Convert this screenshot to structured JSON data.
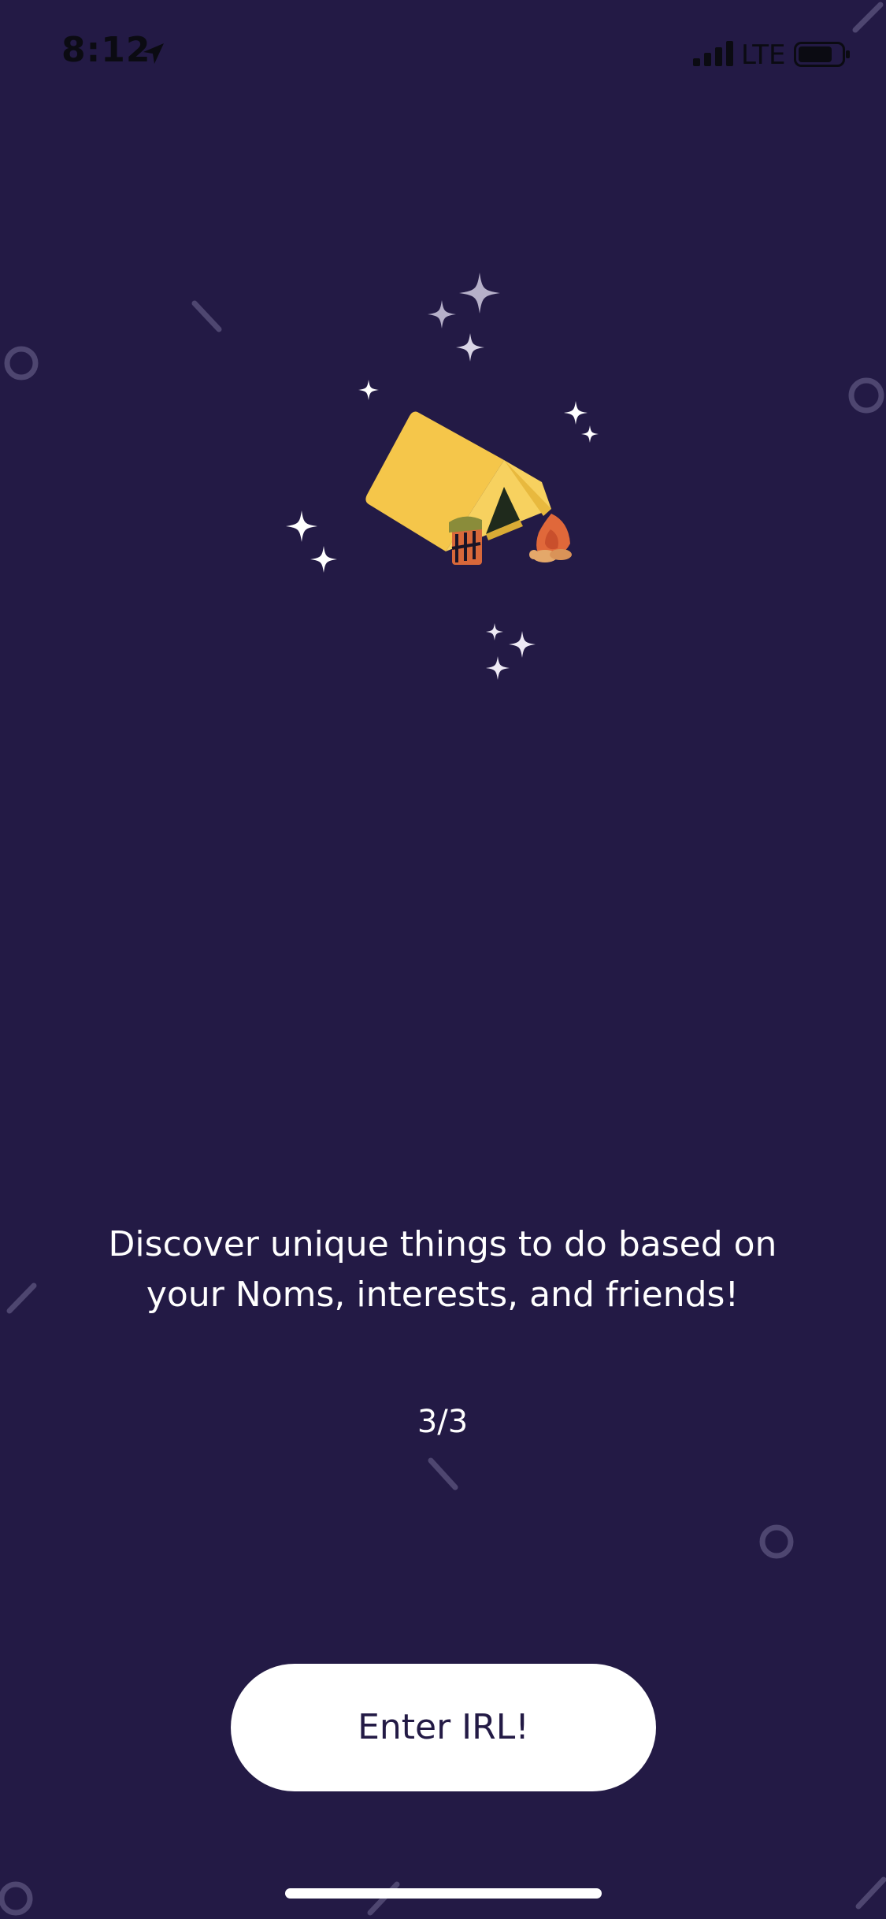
{
  "status_bar": {
    "time": "8:12",
    "network": "LTE",
    "location_icon": "location-arrow-icon",
    "signal_icon": "cellular-signal-icon",
    "battery_icon": "battery-icon"
  },
  "illustration": {
    "icon": "camping-tent-icon"
  },
  "onboarding": {
    "message_line1": "Discover unique things to do based on",
    "message_line2": "your Noms, interests, and friends!",
    "page_indicator": "3/3"
  },
  "cta": {
    "label": "Enter IRL!"
  },
  "colors": {
    "background": "#231a45",
    "button": "#ffffff",
    "button_text": "#231a45",
    "tent": "#f5c64a",
    "campfire": "#e0683a"
  }
}
